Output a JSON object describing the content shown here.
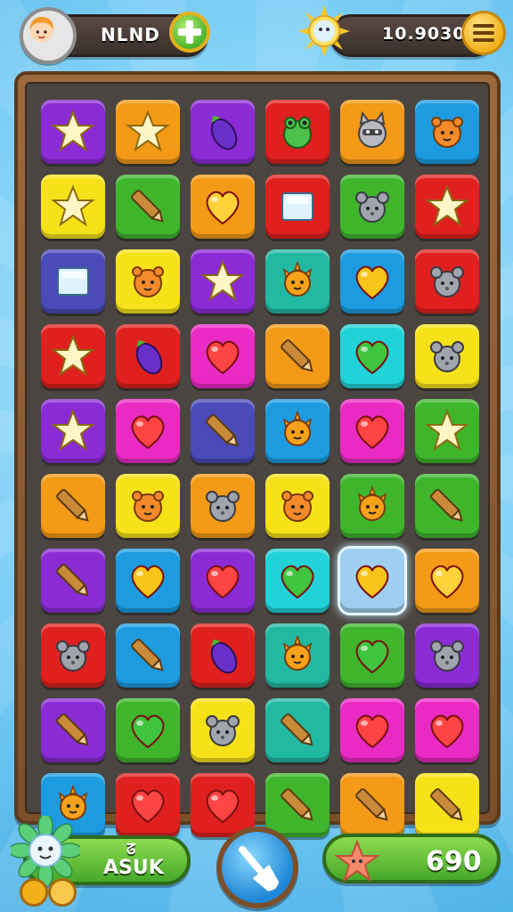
{
  "header": {
    "player_name": "NLND",
    "currency": "10.9030",
    "avatar_icon": "girl-avatar-icon",
    "add_icon": "plus-icon",
    "sun_icon": "sun-icon",
    "menu_icon": "menu-icon"
  },
  "footer": {
    "left_label": "ASUK",
    "left_small": "ᘔ",
    "score": "690",
    "flower_icon": "flower-icon",
    "shovel_icon": "shovel-icon",
    "score_icon": "star-icon"
  },
  "colors": {
    "purple": "#8b2bd6",
    "yellow": "#f7e21a",
    "orange": "#f59a16",
    "red": "#e0201e",
    "blue": "#1c9be0",
    "green": "#3fb52c",
    "teal": "#22b9a3",
    "magenta": "#ea2bc3",
    "cyan": "#20d3d8",
    "navy": "#4a4ab8",
    "glass": "#9fcff0"
  },
  "board": {
    "rows": [
      [
        {
          "bg": "purple",
          "icon": "star"
        },
        {
          "bg": "orange",
          "icon": "star"
        },
        {
          "bg": "purple",
          "icon": "eggplant"
        },
        {
          "bg": "red",
          "icon": "frog"
        },
        {
          "bg": "orange",
          "icon": "raccoon"
        },
        {
          "bg": "blue",
          "icon": "bear"
        }
      ],
      [
        {
          "bg": "yellow",
          "icon": "star"
        },
        {
          "bg": "green",
          "icon": "pencil"
        },
        {
          "bg": "orange",
          "icon": "heart"
        },
        {
          "bg": "red",
          "icon": "block"
        },
        {
          "bg": "green",
          "icon": "mouse"
        },
        {
          "bg": "red",
          "icon": "star"
        }
      ],
      [
        {
          "bg": "navy",
          "icon": "block"
        },
        {
          "bg": "yellow",
          "icon": "bear"
        },
        {
          "bg": "purple",
          "icon": "star"
        },
        {
          "bg": "teal",
          "icon": "sun-critter"
        },
        {
          "bg": "blue",
          "icon": "heart"
        },
        {
          "bg": "red",
          "icon": "mouse"
        }
      ],
      [
        {
          "bg": "red",
          "icon": "star"
        },
        {
          "bg": "red",
          "icon": "eggplant"
        },
        {
          "bg": "magenta",
          "icon": "heart"
        },
        {
          "bg": "orange",
          "icon": "pencil"
        },
        {
          "bg": "cyan",
          "icon": "heart"
        },
        {
          "bg": "yellow",
          "icon": "mouse"
        }
      ],
      [
        {
          "bg": "purple",
          "icon": "star"
        },
        {
          "bg": "magenta",
          "icon": "heart"
        },
        {
          "bg": "navy",
          "icon": "pencil"
        },
        {
          "bg": "blue",
          "icon": "sun-critter"
        },
        {
          "bg": "magenta",
          "icon": "heart"
        },
        {
          "bg": "green",
          "icon": "star"
        }
      ],
      [
        {
          "bg": "orange",
          "icon": "pencil"
        },
        {
          "bg": "yellow",
          "icon": "bear"
        },
        {
          "bg": "orange",
          "icon": "mouse"
        },
        {
          "bg": "yellow",
          "icon": "bear"
        },
        {
          "bg": "green",
          "icon": "sun-critter"
        },
        {
          "bg": "green",
          "icon": "pencil"
        }
      ],
      [
        {
          "bg": "purple",
          "icon": "pencil"
        },
        {
          "bg": "blue",
          "icon": "heart"
        },
        {
          "bg": "purple",
          "icon": "heart"
        },
        {
          "bg": "cyan",
          "icon": "heart"
        },
        {
          "bg": "glass",
          "icon": "heart",
          "selected": true
        },
        {
          "bg": "orange",
          "icon": "heart"
        }
      ],
      [
        {
          "bg": "red",
          "icon": "mouse"
        },
        {
          "bg": "blue",
          "icon": "pencil"
        },
        {
          "bg": "red",
          "icon": "eggplant"
        },
        {
          "bg": "teal",
          "icon": "sun-critter"
        },
        {
          "bg": "green",
          "icon": "heart"
        },
        {
          "bg": "purple",
          "icon": "mouse"
        }
      ],
      [
        {
          "bg": "purple",
          "icon": "pencil"
        },
        {
          "bg": "green",
          "icon": "heart"
        },
        {
          "bg": "yellow",
          "icon": "mouse"
        },
        {
          "bg": "teal",
          "icon": "pencil"
        },
        {
          "bg": "magenta",
          "icon": "heart"
        },
        {
          "bg": "magenta",
          "icon": "heart"
        }
      ],
      [
        {
          "bg": "blue",
          "icon": "sun-critter"
        },
        {
          "bg": "red",
          "icon": "heart"
        },
        {
          "bg": "red",
          "icon": "heart"
        },
        {
          "bg": "green",
          "icon": "pencil"
        },
        {
          "bg": "orange",
          "icon": "pencil"
        },
        {
          "bg": "yellow",
          "icon": "pencil"
        }
      ]
    ]
  }
}
